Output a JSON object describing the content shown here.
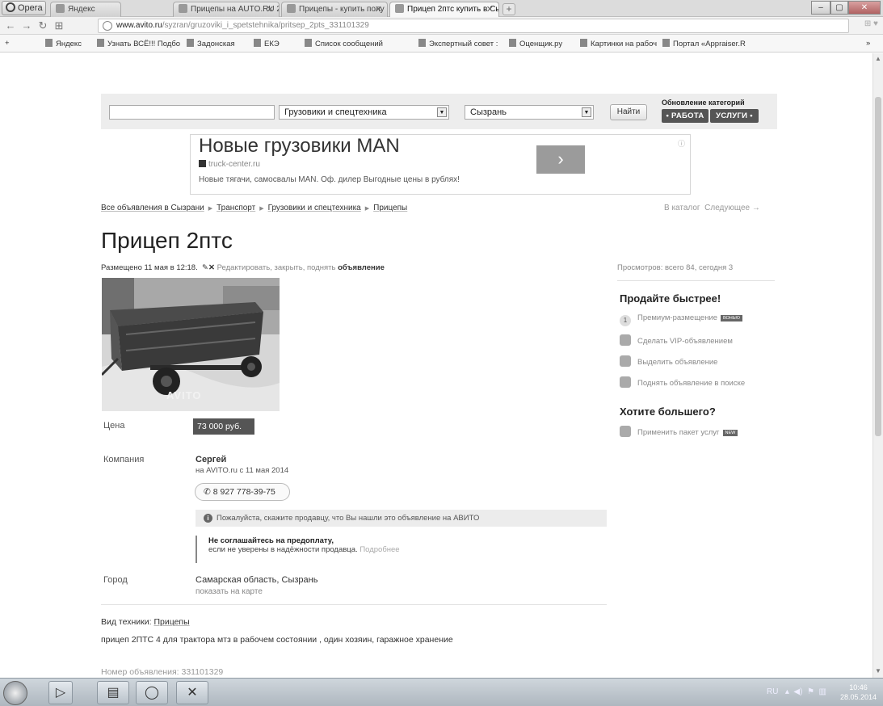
{
  "browser": {
    "menu_label": "Opera",
    "tabs": [
      {
        "title": "Яндекс"
      },
      {
        "title": "Прицепы на AUTO.RU 2("
      },
      {
        "title": "Прицепы - купить полу"
      },
      {
        "title": "Прицеп 2птс купить в Сы"
      }
    ],
    "address": {
      "host": "www.avito.ru",
      "path": "/syzran/gruzoviki_i_spetstehnika/pritsep_2pts_331101329"
    },
    "bookmarks": [
      "Яндекс",
      "Узнать ВСЁ!!! Подбо",
      "Задонская",
      "ЕКЭ",
      "Список сообщений",
      "Экспертный совет :",
      "Оценщик.ру",
      "Картинки на рабоч",
      "Портал «Appraiser.R"
    ]
  },
  "search": {
    "category": "Грузовики и спецтехника",
    "city": "Сызрань",
    "find_label": "Найти",
    "categories_title": "Обновление категорий",
    "work_label": "• РАБОТА",
    "services_label": "УСЛУГИ •"
  },
  "ad": {
    "title": "Новые грузовики MAN",
    "url": "truck-center.ru",
    "text": "Новые тягачи, самосвалы MAN. Оф. дилер Выгодные цены в рублях!",
    "arrow": "›"
  },
  "breadcrumb": {
    "items": [
      "Все объявления в Сызрани",
      "Транспорт",
      "Грузовики и спецтехника",
      "Прицепы"
    ],
    "catalog": "В каталог",
    "next": "Следующее →"
  },
  "listing": {
    "title": "Прицеп 2птс",
    "posted": "Размещено 11 мая в 12:18.",
    "edit_text": "Редактировать, закрыть, поднять",
    "edit_bold": "объявление",
    "views": "Просмотров: всего 84, сегодня 3",
    "watermark": "AVITO",
    "price_label": "Цена",
    "price": "73 000 руб.",
    "company_label": "Компания",
    "seller_name": "Сергей",
    "seller_since": "на AVITO.ru с 11 мая 2014",
    "phone": "8 927 778-39-75",
    "notice": "Пожалуйста, скажите продавцу, что Вы нашли это объявление на АВИТО",
    "warn_title": "Не соглашайтесь на предоплату,",
    "warn_text": "если не уверены в надёжности продавца.",
    "warn_more": "Подробнее",
    "city_label": "Город",
    "city": "Самарская область, Сызрань",
    "map_link": "показать на карте",
    "type_label": "Вид техники:",
    "type_value": "Прицепы",
    "description": "прицеп 2ПТС 4 для трактора мтз в рабочем состоянии , один хозяин, гаражное хранение",
    "ad_number": "Номер объявления: 331101329"
  },
  "sidebar": {
    "sell_title": "Продайте быстрее!",
    "items": [
      {
        "label": "Премиум-размещение",
        "badge": "ВОНЬЮ"
      },
      {
        "label": "Сделать VIP-объявлением"
      },
      {
        "label": "Выделить объявление"
      },
      {
        "label": "Поднять объявление в поиске"
      }
    ],
    "more_title": "Хотите большего?",
    "package": "Применить пакет услуг",
    "package_badge": "NEW"
  },
  "taskbar": {
    "lang": "RU",
    "time": "10:46",
    "date": "28.05.2014"
  }
}
